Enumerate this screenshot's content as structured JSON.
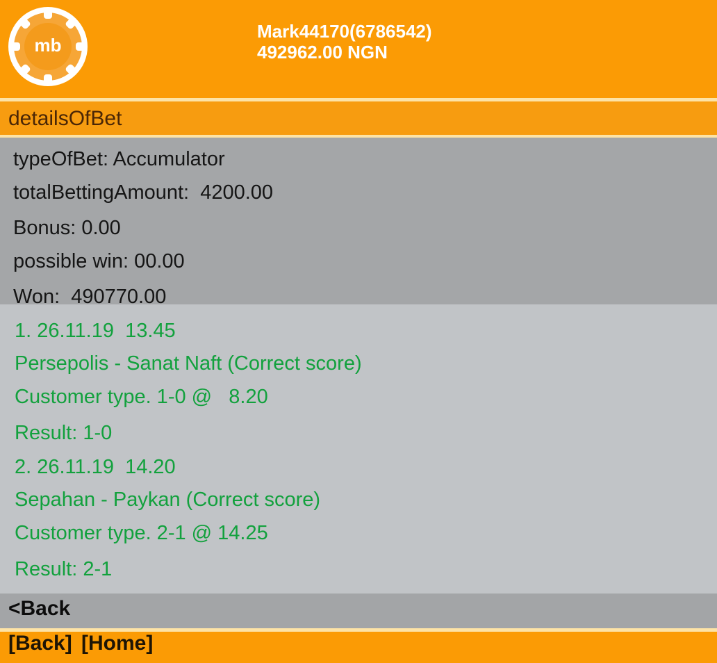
{
  "header": {
    "logo_text": "mb",
    "user": "Mark44170(6786542)",
    "balance": "492962.00 NGN",
    "colors": {
      "bar": "#fb9b05",
      "text": "#ffffff"
    }
  },
  "subheader": {
    "title": "detailsOfBet"
  },
  "summary": {
    "type_of_bet": "typeOfBet: Accumulator",
    "total_amount": "totalBettingAmount:  4200.00",
    "bonus": "Bonus: 0.00",
    "possible_win": "possible win: 00.00",
    "won": "Won:  490770.00"
  },
  "selections": [
    {
      "datetime": "1. 26.11.19  13.45",
      "match": "Persepolis - Sanat Naft (Correct score)",
      "pick": "Customer type. 1-0 @   8.20",
      "result": "Result: 1-0"
    },
    {
      "datetime": "2. 26.11.19  14.20",
      "match": "Sepahan - Paykan (Correct score)",
      "pick": "Customer type. 2-1 @ 14.25",
      "result": "Result: 2-1"
    }
  ],
  "nav": {
    "back_link": "<Back",
    "footer_back": "[Back]",
    "footer_home": "[Home]"
  },
  "colors": {
    "accent": "#fb9b05",
    "win_text": "#12a13d"
  }
}
